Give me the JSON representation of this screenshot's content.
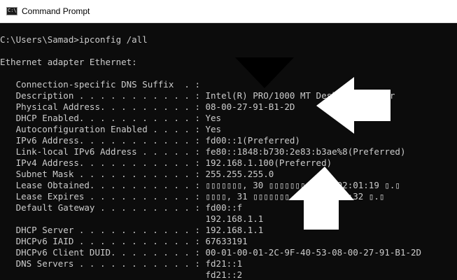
{
  "window": {
    "title": "Command Prompt",
    "icon": "cmd-window-icon",
    "icon_glyph": "C:\\"
  },
  "console": {
    "text_color": "#cccccc",
    "background": "#0c0c0c",
    "lines": [
      "",
      "C:\\Users\\Samad>ipconfig /all",
      "",
      "Ethernet adapter Ethernet:",
      "",
      "   Connection-specific DNS Suffix  . :",
      "   Description . . . . . . . . . . . : Intel(R) PRO/1000 MT Desktop Adapter",
      "   Physical Address. . . . . . . . . : 08-00-27-91-B1-2D",
      "   DHCP Enabled. . . . . . . . . . . : Yes",
      "   Autoconfiguration Enabled . . . . : Yes",
      "   IPv6 Address. . . . . . . . . . . : fd00::1(Preferred)",
      "   Link-local IPv6 Address . . . . . : fe80::1848:b730:2e83:b3ae%8(Preferred)",
      "   IPv4 Address. . . . . . . . . . . : 192.168.1.100(Preferred)",
      "   Subnet Mask . . . . . . . . . . . : 255.255.255.0",
      "   Lease Obtained. . . . . . . . . . : ▯▯▯▯▯▯▯, 30 ▯▯▯▯▯▯▯ 2023 02:01:19 ▯.▯",
      "   Lease Expires . . . . . . . . . . : ▯▯▯▯, 31 ▯▯▯▯▯▯▯ 2023 02:28:32 ▯.▯",
      "   Default Gateway . . . . . . . . . : fd00::f",
      "                                       192.168.1.1",
      "   DHCP Server . . . . . . . . . . . : 192.168.1.1",
      "   DHCPv6 IAID . . . . . . . . . . . : 67633191",
      "   DHCPv6 Client DUID. . . . . . . . : 00-01-00-01-2C-9F-40-53-08-00-27-91-B1-2D",
      "   DNS Servers . . . . . . . . . . . : fd21::1",
      "                                       fd21::2"
    ]
  },
  "annotations": {
    "arrow_color": "#ffffff",
    "down_arrow_color": "#000000",
    "arrows": [
      "black-down-arrow-icon",
      "white-left-arrow-icon",
      "white-up-arrow-icon"
    ]
  }
}
